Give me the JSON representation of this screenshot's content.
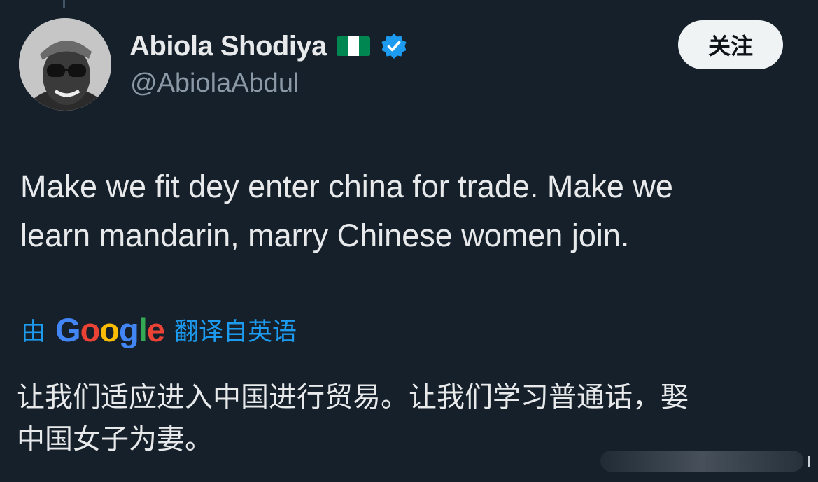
{
  "author": {
    "display_name": "Abiola Shodiya",
    "handle": "@AbiolaAbdul",
    "flag_icon": "nigeria-flag-icon",
    "verified_icon": "verified-badge-icon",
    "avatar_icon": "profile-avatar"
  },
  "follow_button": {
    "label": "关注"
  },
  "tweet": {
    "line1": "Make we fit dey enter china for trade. Make we",
    "line2": "learn mandarin, marry Chinese women join."
  },
  "translation": {
    "prefix": "由",
    "provider": {
      "G": "G",
      "o1": "o",
      "o2": "o",
      "g": "g",
      "l": "l",
      "e": "e"
    },
    "suffix": "翻译自英语",
    "line1": "让我们适应进入中国进行贸易。让我们学习普通话，娶",
    "line2": "中国女子为妻。"
  },
  "colors": {
    "background": "#15202b",
    "text": "#e7e9ea",
    "secondary_text": "#8b98a5",
    "accent": "#1d9bf0",
    "google_blue": "#4285f4",
    "google_red": "#ea4335",
    "google_yellow": "#fbbc05",
    "google_green": "#34a853"
  }
}
